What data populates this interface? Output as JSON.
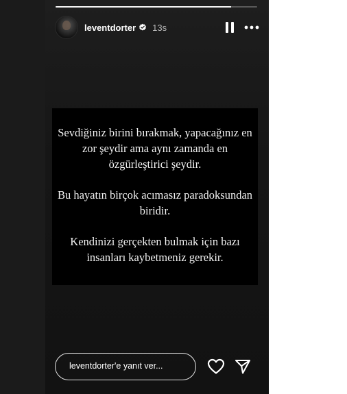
{
  "story": {
    "progress_fraction": 0.87,
    "user": {
      "username": "leventdorter",
      "verified": true,
      "time_ago": "13s"
    },
    "controls": {
      "pause_icon": "pause-icon",
      "more_icon": "more-options-icon"
    },
    "card": {
      "paragraphs": [
        "Sevdiğiniz birini bırakmak, yapacağınız en zor şeydir ama aynı zamanda en özgürleştirici şeydir.",
        "Bu hayatın birçok acımasız paradoksundan biridir.",
        "Kendinizi gerçekten bulmak için bazı insanları kaybetmeniz gerekir."
      ]
    },
    "reply": {
      "placeholder": "leventdorter'e yanıt ver..."
    },
    "actions": {
      "like_icon": "heart-icon",
      "share_icon": "send-icon"
    }
  },
  "colors": {
    "background": "#1b1b1b",
    "card": "#000000",
    "text": "#ffffff",
    "verified_badge": "#ffffff"
  }
}
